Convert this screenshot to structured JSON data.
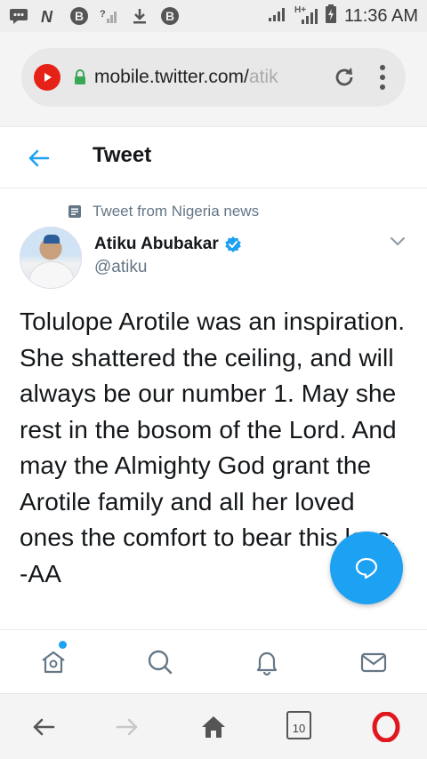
{
  "status_bar": {
    "time": "11:36 AM",
    "network_label": "H+",
    "left_icons": [
      "message-icon",
      "nfc-icon",
      "bitcoin-icon",
      "signal-question-icon",
      "download-icon",
      "bitcoin-icon"
    ],
    "right_icons": [
      "signal-icon",
      "signal-hplus-icon",
      "battery-charging-icon"
    ]
  },
  "browser": {
    "url_main": "mobile.twitter.com/",
    "url_faded": "atik",
    "tabs_count": "10",
    "favicon": "youtube-play-icon",
    "secure_icon": "lock-icon",
    "brand_color": "#e62117"
  },
  "header": {
    "title": "Tweet"
  },
  "tweet": {
    "context": "Tweet from Nigeria news",
    "author_name": "Atiku Abubakar",
    "author_handle": "@atiku",
    "verified": true,
    "text": "Tolulope Arotile was an inspiration. She shattered the ceiling, and will always be our number 1. May she rest in the bosom of the Lord. And may the Almighty God grant the Arotile family and all her loved ones the comfort to bear this loss. -AA"
  },
  "colors": {
    "twitter_blue": "#1da1f2",
    "text_primary": "#14171a",
    "text_secondary": "#657786",
    "opera_red": "#e0171f"
  },
  "bottom_nav": {
    "items": [
      "home-icon",
      "search-icon",
      "notifications-icon",
      "messages-icon"
    ],
    "home_has_unread": true
  },
  "browser_nav": {
    "items": [
      "back-icon",
      "forward-icon",
      "home-icon",
      "tabs-icon",
      "opera-menu-icon"
    ]
  }
}
